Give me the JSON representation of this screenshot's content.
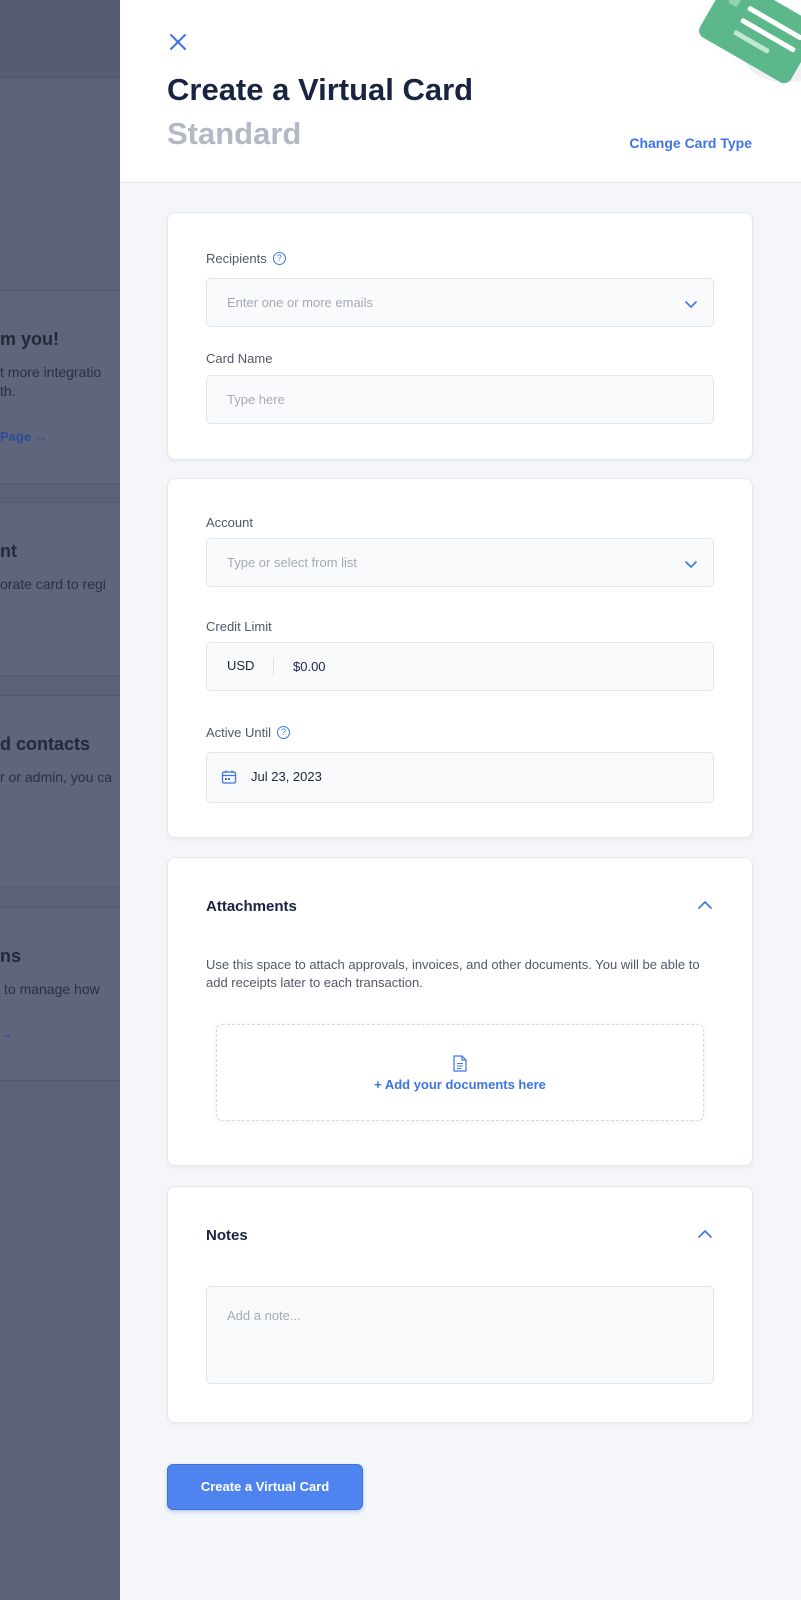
{
  "background": {
    "cards": [
      {
        "heading": "m you!",
        "line1": "t more integratio",
        "line2": "th.",
        "link": "Page →"
      },
      {
        "heading": "nt",
        "line1": "orate card to regi",
        "line2": "",
        "link": ""
      },
      {
        "heading": "d contacts",
        "line1": "r or admin, you ca",
        "line2": "",
        "link": ""
      },
      {
        "heading": "ns",
        "line1": "to manage how",
        "line2": "",
        "link": "→"
      }
    ]
  },
  "header": {
    "title": "Create a Virtual Card",
    "subtitle": "Standard",
    "change_card_type": "Change Card Type"
  },
  "details": {
    "recipients_label": "Recipients",
    "recipients_placeholder": "Enter one or more emails",
    "card_name_label": "Card Name",
    "card_name_placeholder": "Type here"
  },
  "limits": {
    "account_label": "Account",
    "account_placeholder": "Type or select from list",
    "credit_limit_label": "Credit Limit",
    "currency": "USD",
    "credit_limit_value": "$0.00",
    "active_until_label": "Active Until",
    "active_until_value": "Jul 23, 2023"
  },
  "attachments": {
    "title": "Attachments",
    "description": "Use this space to attach approvals, invoices, and other documents. You will be able to add receipts later to each transaction.",
    "add_documents": "+ Add your documents here"
  },
  "notes": {
    "title": "Notes",
    "placeholder": "Add a note..."
  },
  "submit_label": "Create a Virtual Card",
  "colors": {
    "accent": "#3e74e4",
    "button": "#4f84f0",
    "card_art": "#5cb88a"
  }
}
